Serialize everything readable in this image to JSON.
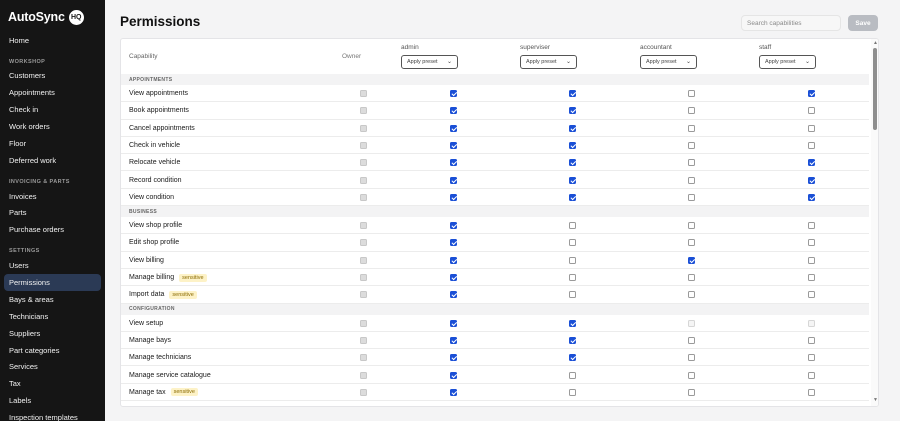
{
  "app": {
    "brand": "AutoSync",
    "badge": "HQ"
  },
  "sidebar": {
    "home": "Home",
    "sections": [
      {
        "title": "WORKSHOP",
        "items": [
          "Customers",
          "Appointments",
          "Check in",
          "Work orders",
          "Floor",
          "Deferred work"
        ]
      },
      {
        "title": "INVOICING & PARTS",
        "items": [
          "Invoices",
          "Parts",
          "Purchase orders"
        ]
      },
      {
        "title": "SETTINGS",
        "items": [
          "Users",
          "Permissions",
          "Bays & areas",
          "Technicians",
          "Suppliers",
          "Part categories",
          "Services",
          "Tax",
          "Labels",
          "Inspection templates"
        ]
      }
    ],
    "active": "Permissions"
  },
  "header": {
    "title": "Permissions",
    "search_placeholder": "Search capabilities",
    "save_label": "Save"
  },
  "table": {
    "capability_header": "Capability",
    "owner_header": "Owner",
    "roles": [
      "admin",
      "superviser",
      "accountant",
      "staff"
    ],
    "preset_label": "Apply preset",
    "sensitive_label": "sensitive",
    "sections": [
      {
        "name": "APPOINTMENTS",
        "rows": [
          {
            "label": "View appointments",
            "values": [
              1,
              1,
              0,
              1
            ]
          },
          {
            "label": "Book appointments",
            "values": [
              1,
              1,
              0,
              0
            ]
          },
          {
            "label": "Cancel appointments",
            "values": [
              1,
              1,
              0,
              0
            ]
          },
          {
            "label": "Check in vehicle",
            "values": [
              1,
              1,
              0,
              0
            ]
          },
          {
            "label": "Relocate vehicle",
            "values": [
              1,
              1,
              0,
              1
            ]
          },
          {
            "label": "Record condition",
            "values": [
              1,
              1,
              0,
              1
            ]
          },
          {
            "label": "View condition",
            "values": [
              1,
              1,
              0,
              1
            ]
          }
        ]
      },
      {
        "name": "BUSINESS",
        "rows": [
          {
            "label": "View shop profile",
            "values": [
              1,
              0,
              0,
              0
            ]
          },
          {
            "label": "Edit shop profile",
            "values": [
              1,
              0,
              0,
              0
            ]
          },
          {
            "label": "View billing",
            "values": [
              1,
              0,
              1,
              0
            ]
          },
          {
            "label": "Manage billing",
            "sensitive": true,
            "values": [
              1,
              0,
              0,
              0
            ]
          },
          {
            "label": "Import data",
            "sensitive": true,
            "values": [
              1,
              0,
              0,
              0
            ]
          }
        ]
      },
      {
        "name": "CONFIGURATION",
        "rows": [
          {
            "label": "View setup",
            "values": [
              1,
              1,
              2,
              2
            ]
          },
          {
            "label": "Manage bays",
            "values": [
              1,
              1,
              0,
              0
            ]
          },
          {
            "label": "Manage technicians",
            "values": [
              1,
              1,
              0,
              0
            ]
          },
          {
            "label": "Manage service catalogue",
            "values": [
              1,
              0,
              0,
              0
            ]
          },
          {
            "label": "Manage tax",
            "sensitive": true,
            "values": [
              1,
              0,
              0,
              0
            ]
          }
        ]
      }
    ]
  }
}
